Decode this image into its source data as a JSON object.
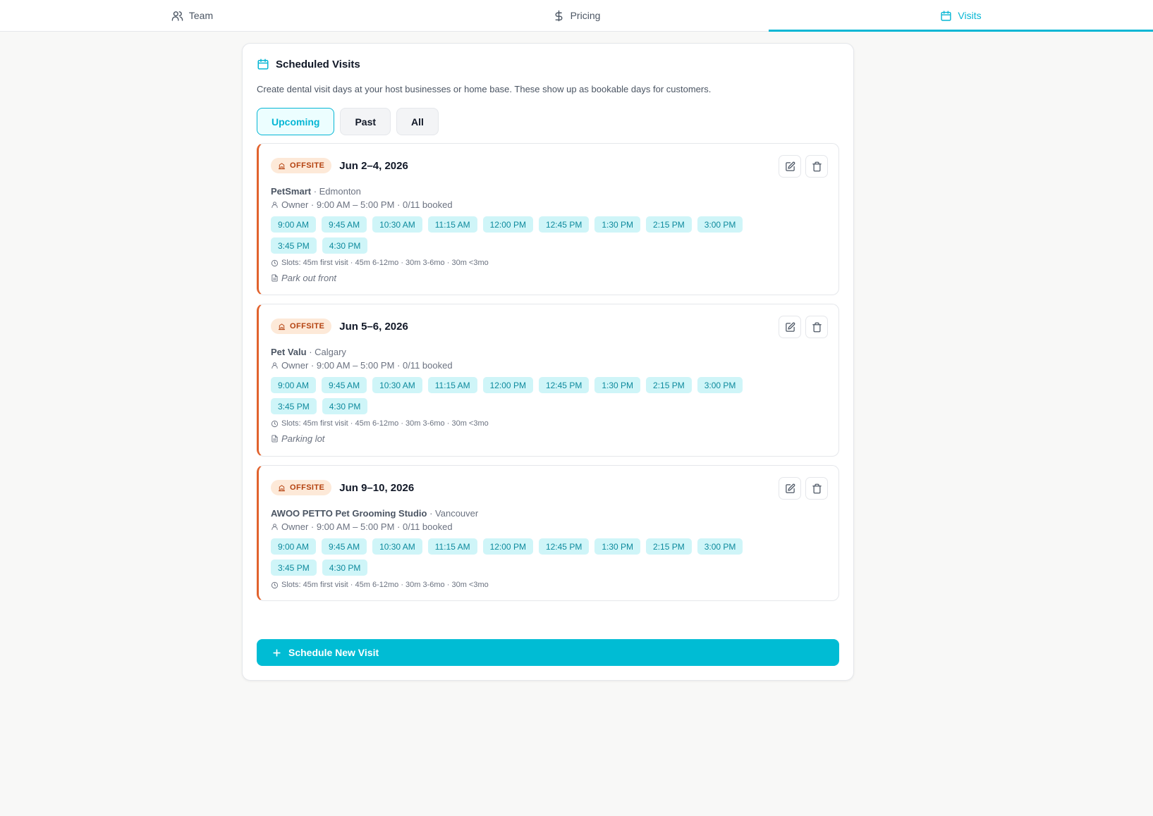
{
  "tabs": [
    {
      "label": "Team",
      "icon": "users-icon"
    },
    {
      "label": "Pricing",
      "icon": "dollar-icon"
    },
    {
      "label": "Visits",
      "icon": "calendar-icon",
      "active": true
    }
  ],
  "card": {
    "title": "Scheduled Visits",
    "description": "Create dental visit days at your host businesses or home base. These show up as bookable days for customers.",
    "filters": [
      "Upcoming",
      "Past",
      "All"
    ],
    "active_filter": "Upcoming",
    "new_button": "Schedule New Visit"
  },
  "accent_color": "#06b6d4",
  "offsite_color": "#e1622d",
  "visits": [
    {
      "badge": "OFFSITE",
      "date": "Jun 2–4, 2026",
      "business": "PetSmart",
      "location": " · Edmonton",
      "owner": "Owner · 9:00 AM – 5:00 PM · 0/11 booked",
      "slots": [
        "9:00 AM",
        "9:45 AM",
        "10:30 AM",
        "11:15 AM",
        "12:00 PM",
        "12:45 PM",
        "1:30 PM",
        "2:15 PM",
        "3:00 PM",
        "3:45 PM",
        "4:30 PM"
      ],
      "slot_rules": "Slots: 45m first visit · 45m 6-12mo · 30m 3-6mo · 30m <3mo",
      "note": "Park out front"
    },
    {
      "badge": "OFFSITE",
      "date": "Jun 5–6, 2026",
      "business": "Pet Valu",
      "location": " · Calgary",
      "owner": "Owner · 9:00 AM – 5:00 PM · 0/11 booked",
      "slots": [
        "9:00 AM",
        "9:45 AM",
        "10:30 AM",
        "11:15 AM",
        "12:00 PM",
        "12:45 PM",
        "1:30 PM",
        "2:15 PM",
        "3:00 PM",
        "3:45 PM",
        "4:30 PM"
      ],
      "slot_rules": "Slots: 45m first visit · 45m 6-12mo · 30m 3-6mo · 30m <3mo",
      "note": "Parking lot"
    },
    {
      "badge": "OFFSITE",
      "date": "Jun 9–10, 2026",
      "business": "AWOO PETTO Pet Grooming Studio",
      "location": " · Vancouver",
      "owner": "Owner · 9:00 AM – 5:00 PM · 0/11 booked",
      "slots": [
        "9:00 AM",
        "9:45 AM",
        "10:30 AM",
        "11:15 AM",
        "12:00 PM",
        "12:45 PM",
        "1:30 PM",
        "2:15 PM",
        "3:00 PM",
        "3:45 PM",
        "4:30 PM"
      ],
      "slot_rules": "Slots: 45m first visit · 45m 6-12mo · 30m 3-6mo · 30m <3mo",
      "note": ""
    }
  ]
}
